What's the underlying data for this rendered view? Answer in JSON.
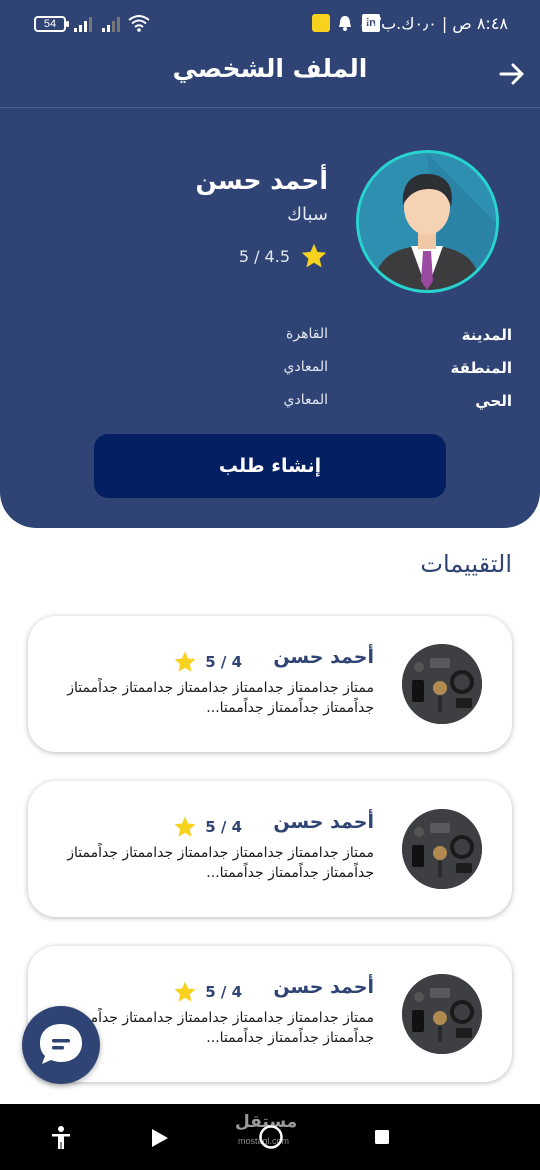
{
  "status_bar": {
    "time": "٨:٤٨ ص | ٠٫٠ك.ب/ث",
    "battery": "54"
  },
  "header": {
    "title": "الملف الشخصي"
  },
  "profile": {
    "name": "أحمد حسن",
    "role": "سباك",
    "rating": "5 / 4.5",
    "info": [
      {
        "label": "المدينة",
        "value": "القاهرة"
      },
      {
        "label": "المنطقة",
        "value": "المعادي"
      },
      {
        "label": "الحي",
        "value": "المعادي"
      }
    ],
    "create_button_label": "إنشاء طلب"
  },
  "reviews": {
    "title": "التقييمات",
    "items": [
      {
        "name": "أحمد حسن",
        "rating": "5 / 4",
        "text": "ممتاز جداممتاز جداممتاز جداممتاز جداممتاز جداًممتاز جداًممتاز جداًممتاز جداًممتا..."
      },
      {
        "name": "أحمد حسن",
        "rating": "5 / 4",
        "text": "ممتاز جداممتاز جداممتاز جداممتاز جداممتاز جداًممتاز جداًممتاز جداًممتاز جداًممتا..."
      },
      {
        "name": "أحمد حسن",
        "rating": "5 / 4",
        "text": "ممتاز جداممتاز جداممتاز جداممتاز جداممتاز جداًممتاز جداًممتاز جداًممتاز جداًممتا..."
      }
    ]
  },
  "navbar": {
    "watermark": "مستقل",
    "watermark_sub": "mostaql.com"
  },
  "colors": {
    "primary": "#2f4474",
    "button": "#031f62",
    "accent_ring": "#28d4cf",
    "star": "#f7d21e"
  },
  "icons": [
    "wifi-icon",
    "signal-icon",
    "battery-icon",
    "linkedin-icon",
    "notification-icon",
    "back-arrow-icon",
    "star-icon",
    "chat-icon",
    "accessibility-icon",
    "back-triangle-icon",
    "home-circle-icon",
    "recents-square-icon"
  ]
}
